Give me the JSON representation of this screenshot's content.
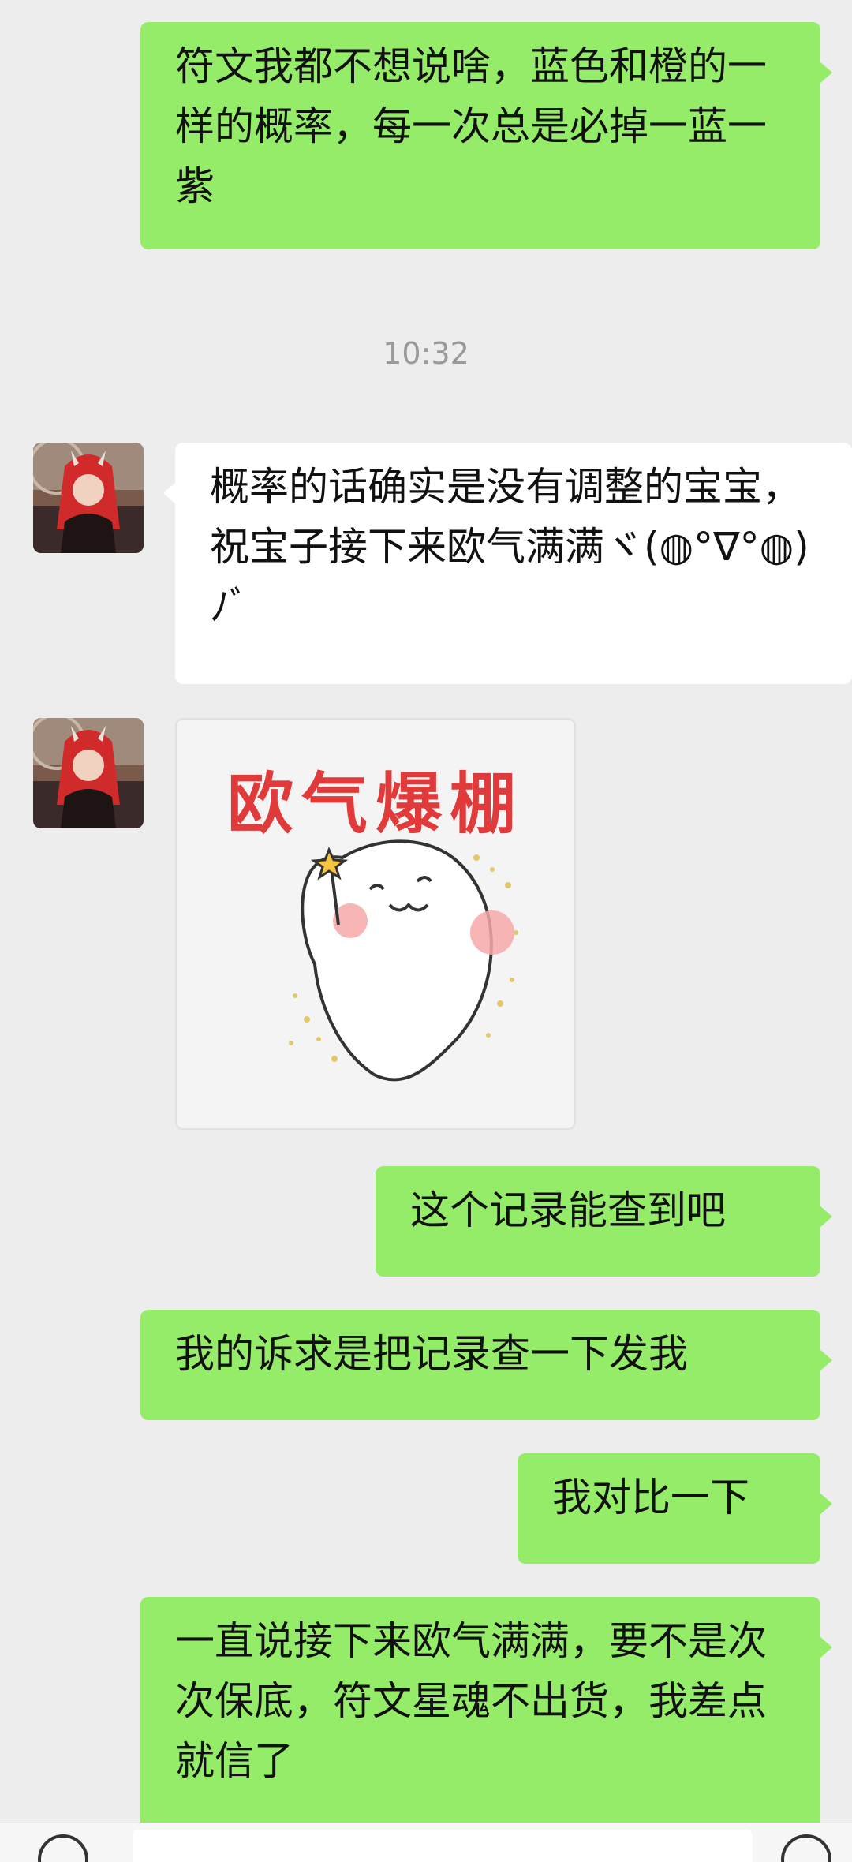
{
  "messages": [
    {
      "id": "m1",
      "side": "me",
      "text": "符文我都不想说啥，蓝色和橙的一样的概率，每一次总是必掉一蓝一紫"
    },
    {
      "id": "m2",
      "side": "them",
      "text": "概率的话确实是没有调整的宝宝，祝宝子接下来欧气满满ヾ(◍°∇°◍)ﾉﾞ"
    },
    {
      "id": "m3",
      "side": "me",
      "text": "这个记录能查到吧"
    },
    {
      "id": "m4",
      "side": "me",
      "text": "我的诉求是把记录查一下发我"
    },
    {
      "id": "m5",
      "side": "me",
      "text": "我对比一下"
    },
    {
      "id": "m6",
      "side": "me",
      "text": "一直说接下来欧气满满，要不是次次保底，符文星魂不出货，我差点就信了"
    }
  ],
  "timestamp": "10:32",
  "sticker": {
    "text": "欧气爆棚",
    "icon": "mascot-with-star-wand"
  },
  "colors": {
    "background": "#ededed",
    "my_bubble": "#95ec69",
    "their_bubble": "#ffffff",
    "timestamp": "#9a9a9a",
    "sticker_text": "#e03a3a"
  }
}
